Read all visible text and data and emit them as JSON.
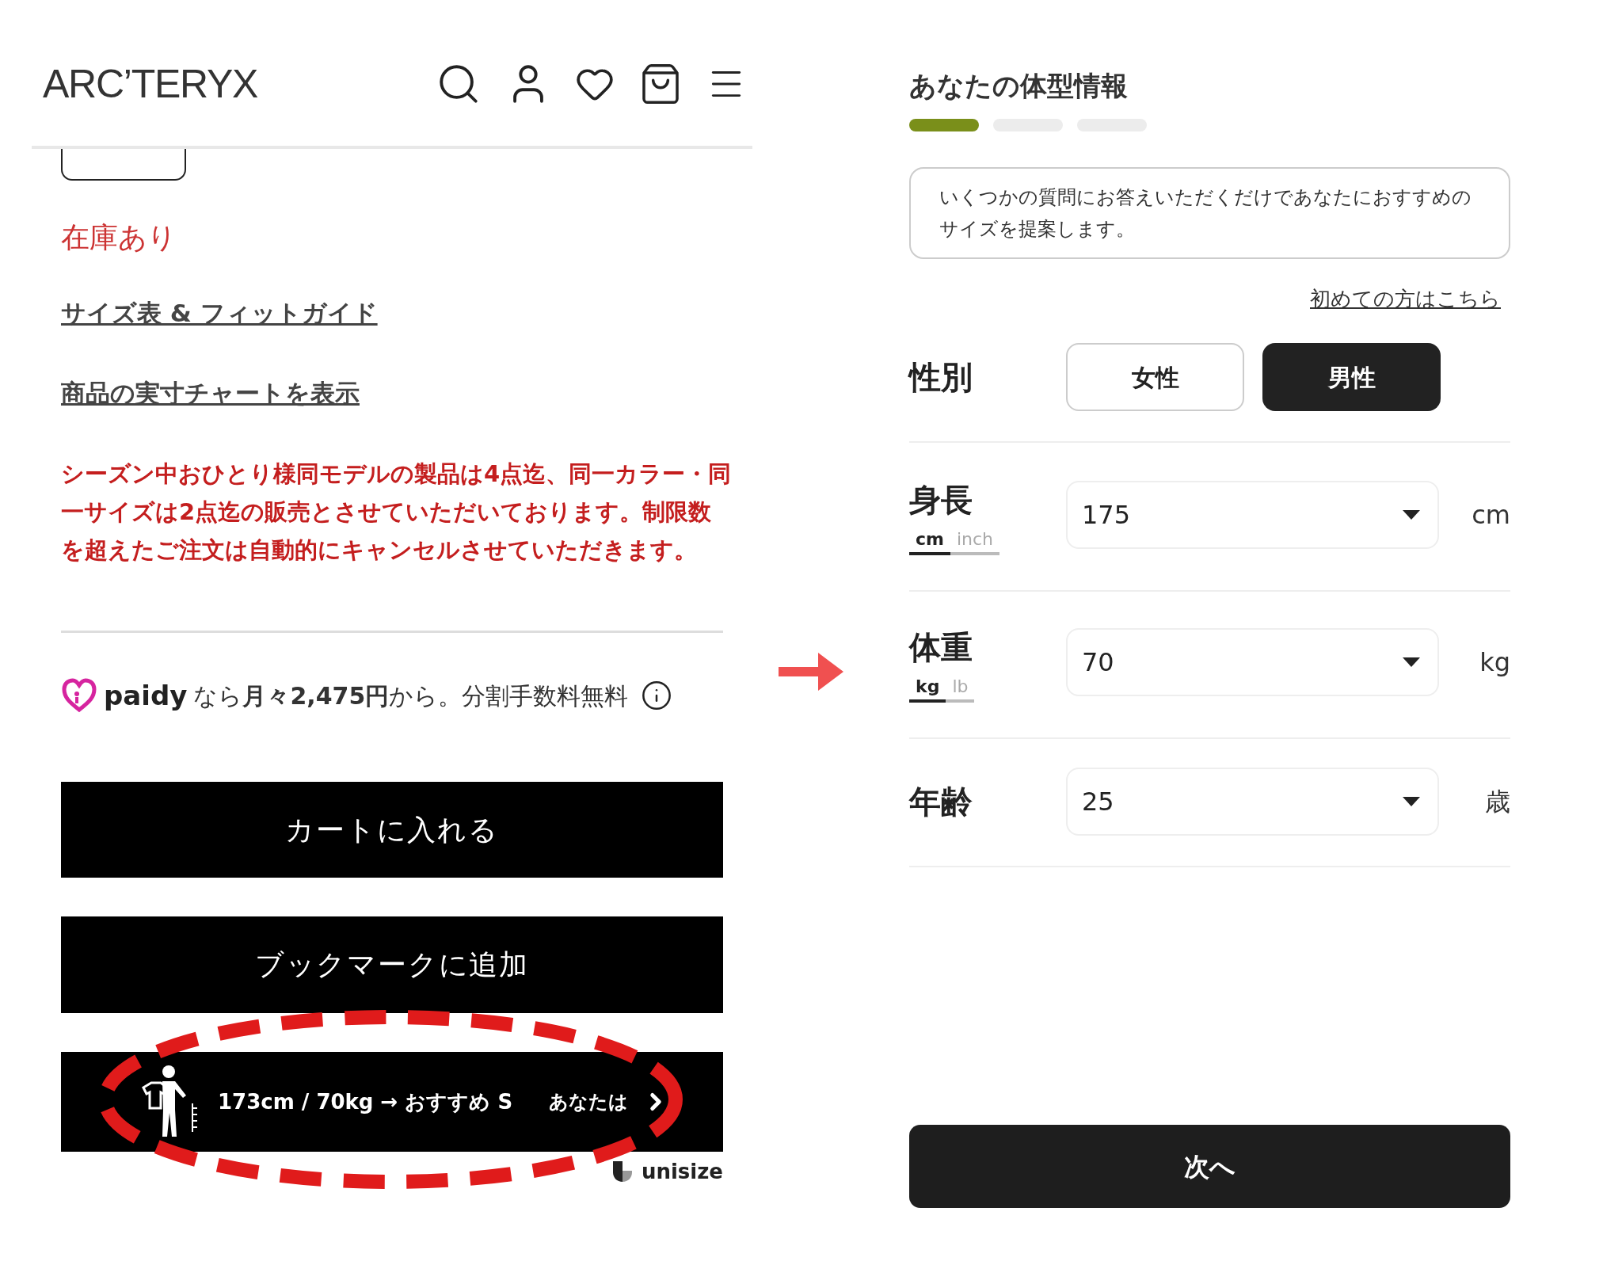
{
  "header": {
    "logo": "ARC’TERYX"
  },
  "product": {
    "stock": "在庫あり",
    "links": [
      "サイズ表 & フィットガイド",
      "商品の実寸チャートを表示"
    ],
    "notice": "シーズン中おひとり様同モデルの製品は4点迄、同一カラー・同一サイズは2点迄の販売とさせていただいております。制限数を超えたご注文は自動的にキャンセルさせていただきます。",
    "paidy": {
      "brand": "paidy",
      "text": "なら**月々2,475円**から。分割手数料無料"
    },
    "buttons": [
      "カートに入れる",
      "ブックマークに追加"
    ],
    "unisize": {
      "recommendation": "173cm / 70kg → おすすめ S",
      "cta": "あなたは",
      "brand": "unisize"
    }
  },
  "form": {
    "title": "あなたの体型情報",
    "steps": [
      {
        "done": true
      },
      {
        "done": false
      },
      {
        "done": false
      }
    ],
    "intro": "いくつかの質問にお答えいただくだけであなたにおすすめのサイズを提案します。",
    "first_time_link": "初めての方はこちら",
    "gender": {
      "label": "性別",
      "options": [
        {
          "label": "女性",
          "selected": false
        },
        {
          "label": "男性",
          "selected": true
        }
      ]
    },
    "fields": [
      {
        "label": "身長",
        "units": [
          {
            "label": "cm",
            "selected": true
          },
          {
            "label": "inch",
            "selected": false
          }
        ],
        "value": "175",
        "unit": "cm"
      },
      {
        "label": "体重",
        "units": [
          {
            "label": "kg",
            "selected": true
          },
          {
            "label": "lb",
            "selected": false
          }
        ],
        "value": "70",
        "unit": "kg"
      },
      {
        "label": "年齢",
        "value": "25",
        "unit": "歳"
      }
    ],
    "next": "次へ"
  }
}
